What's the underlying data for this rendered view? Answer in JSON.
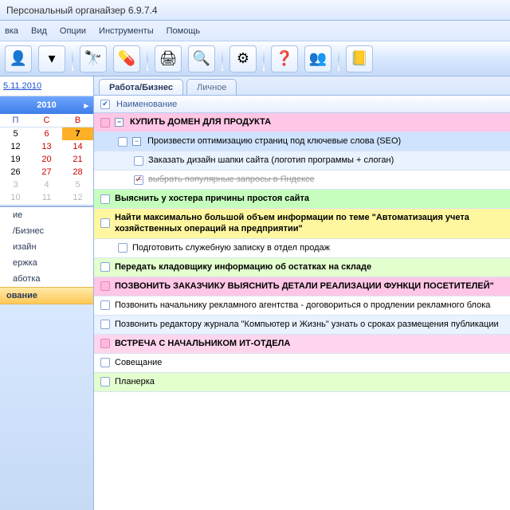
{
  "title": "Персональный органайзер 6.9.7.4",
  "menu": [
    "вка",
    "Вид",
    "Опции",
    "Инструменты",
    "Помощь"
  ],
  "toolbarIcons": [
    "user",
    "funnel",
    "binoculars",
    "pill",
    "printer",
    "preview",
    "gear",
    "help",
    "people",
    "notepad"
  ],
  "dateLink": "5.11.2010",
  "monthHeader": "2010",
  "weekdays": [
    "П",
    "С",
    "В"
  ],
  "calRows": [
    [
      "5",
      "6",
      "7",
      [
        "",
        "",
        "today"
      ]
    ],
    [
      "12",
      "13",
      "14",
      [
        "",
        "sat",
        "sun"
      ]
    ],
    [
      "19",
      "20",
      "21",
      [
        "",
        "sat",
        "sun"
      ]
    ],
    [
      "26",
      "27",
      "28",
      [
        "",
        "sat",
        "sun"
      ]
    ],
    [
      "3",
      "4",
      "5",
      [
        "dim",
        "dim",
        "dim"
      ]
    ],
    [
      "10",
      "11",
      "12",
      [
        "dim",
        "dim",
        "dim"
      ]
    ]
  ],
  "categories": [
    "ие",
    "/Бизнес",
    "изайн",
    "ержка",
    "аботка"
  ],
  "categorySelected": "ование",
  "tabs": {
    "active": "Работа/Бизнес",
    "inactive": "Личное"
  },
  "columnHeader": "Наименование",
  "tasks": [
    {
      "text": "КУПИТЬ ДОМЕН ДЛЯ ПРОДУКТА",
      "cls": "bg-pink bold",
      "tree": "−",
      "chkCls": "pink"
    },
    {
      "text": "Произвести оптимизацию страниц под ключевые слова (SEO)",
      "cls": "bg-blue indent1",
      "tree": "−"
    },
    {
      "text": "Заказать дизайн шапки сайта (логотип программы + слоган)",
      "cls": "bg-blueL indent2"
    },
    {
      "text": "выбрать популярные запросы в Яндексе",
      "cls": "bg-white indent2 strike",
      "done": true
    },
    {
      "text": "Выяснить у хостера причины простоя сайта",
      "cls": "bg-green bold"
    },
    {
      "text": "Найти максимально большой объем информации по теме \"Автоматизация учета хозяйственных операций на предприятии\"",
      "cls": "bg-yellow bold"
    },
    {
      "text": "Подготовить служебную записку в отдел продаж",
      "cls": "bg-white indent1"
    },
    {
      "text": "Передать кладовщику информацию об остатках на складе",
      "cls": "bg-ltgrn bold"
    },
    {
      "text": "ПОЗВОНИТЬ ЗАКАЗЧИКУ ВЫЯСНИТЬ ДЕТАЛИ РЕАЛИЗАЦИИ ФУНКЦИ ПОСЕТИТЕЛЕЙ\"",
      "cls": "bg-pink bold",
      "chkCls": "pink"
    },
    {
      "text": "Позвонить начальнику рекламного агентства - договориться о продлении рекламного блока",
      "cls": "bg-white"
    },
    {
      "text": "Позвонить редактору журнала \"Компьютер и Жизнь\" узнать о сроках размещения публикации",
      "cls": "bg-blueL"
    },
    {
      "text": "ВСТРЕЧА С НАЧАЛЬНИКОМ ИТ-ОТДЕЛА",
      "cls": "bg-pink2 bold",
      "chkCls": "pink"
    },
    {
      "text": "Совещание",
      "cls": "bg-white"
    },
    {
      "text": "Планерка",
      "cls": "bg-ltgrn"
    }
  ]
}
